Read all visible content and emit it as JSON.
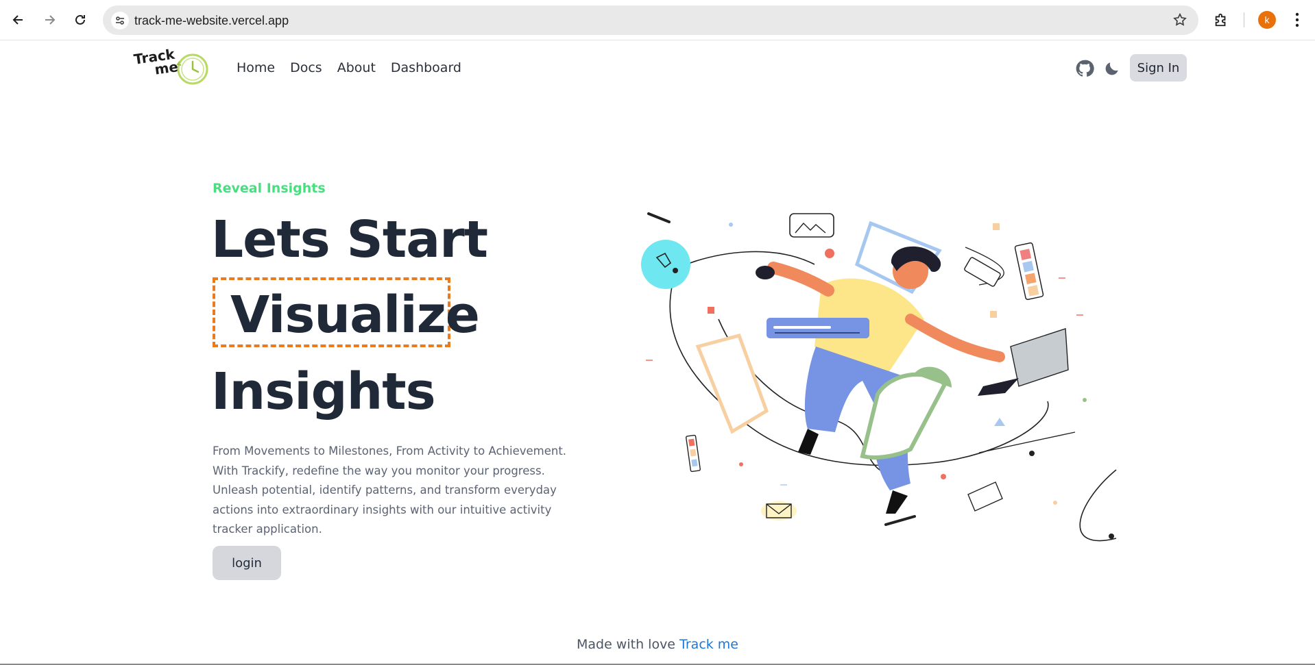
{
  "browser": {
    "url": "track-me-website.vercel.app",
    "profile_initial": "k",
    "profile_color": "#e8710a"
  },
  "site": {
    "logo_text_line1": "Track",
    "logo_text_line2": "me",
    "nav": [
      "Home",
      "Docs",
      "About",
      "Dashboard"
    ],
    "signin_label": "Sign In",
    "icons": [
      "github-icon",
      "moon-icon"
    ]
  },
  "hero": {
    "eyebrow": "Reveal Insights",
    "eyebrow_color": "#4ade80",
    "title_line1": "Lets Start",
    "title_rotating_word": "Visualize",
    "title_line3": "Insights",
    "highlight_color": "#ea7a1c",
    "description": "From Movements to Milestones, From Activity to Achievement. With Trackify, redefine the way you monitor your progress. Unleash potential, identify patterns, and transform everyday actions into extraordinary insights with our intuitive activity tracker application.",
    "login_label": "login"
  },
  "footer": {
    "prefix": "Made with love",
    "link_text": "Track me",
    "link_color": "#1d77d6"
  }
}
